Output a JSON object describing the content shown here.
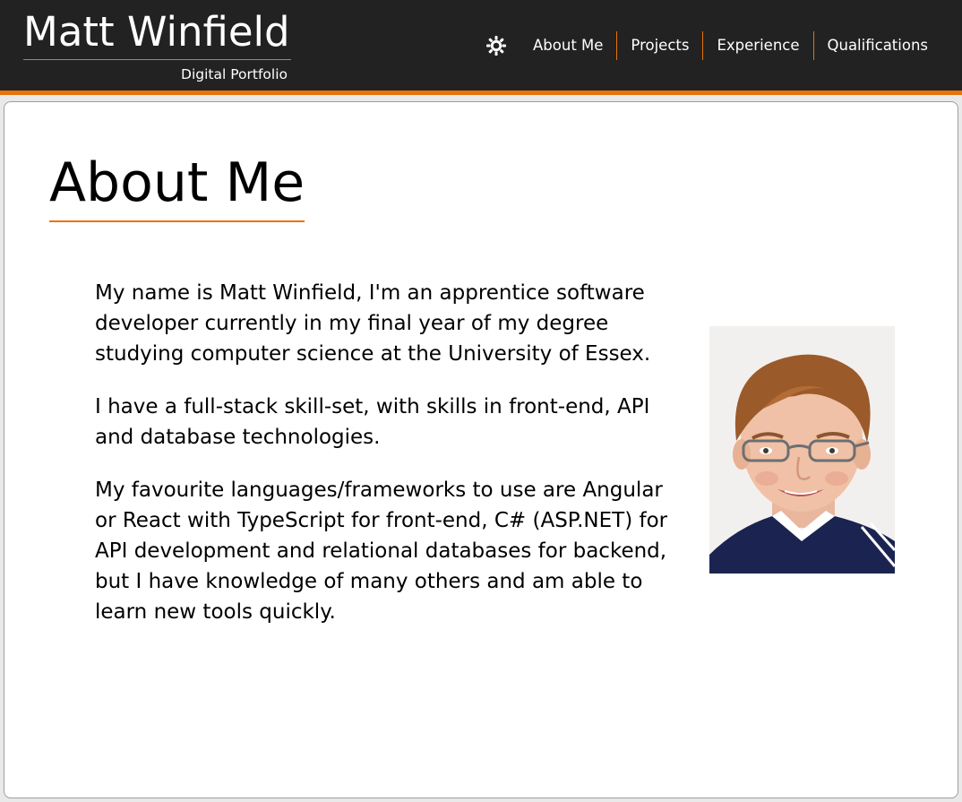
{
  "header": {
    "title": "Matt Winfield",
    "subtitle": "Digital Portfolio",
    "theme_toggle_icon": "sun-icon",
    "nav": [
      {
        "label": "About Me"
      },
      {
        "label": "Projects"
      },
      {
        "label": "Experience"
      },
      {
        "label": "Qualifications"
      }
    ]
  },
  "main": {
    "section_title": "About Me",
    "paragraphs": [
      "My name is Matt Winfield, I'm an apprentice software developer currently in my final year of my degree studying computer science at the University of Essex.",
      "I have a full-stack skill-set, with skills in front-end, API and database technologies.",
      "My favourite languages/frameworks to use are Angular or React with TypeScript for front-end, C# (ASP.NET) for API development and relational databases for backend, but I have knowledge of many others and am able to learn new tools quickly."
    ]
  },
  "colors": {
    "header_bg": "#222222",
    "accent": "#e8730c",
    "text": "#000000"
  }
}
